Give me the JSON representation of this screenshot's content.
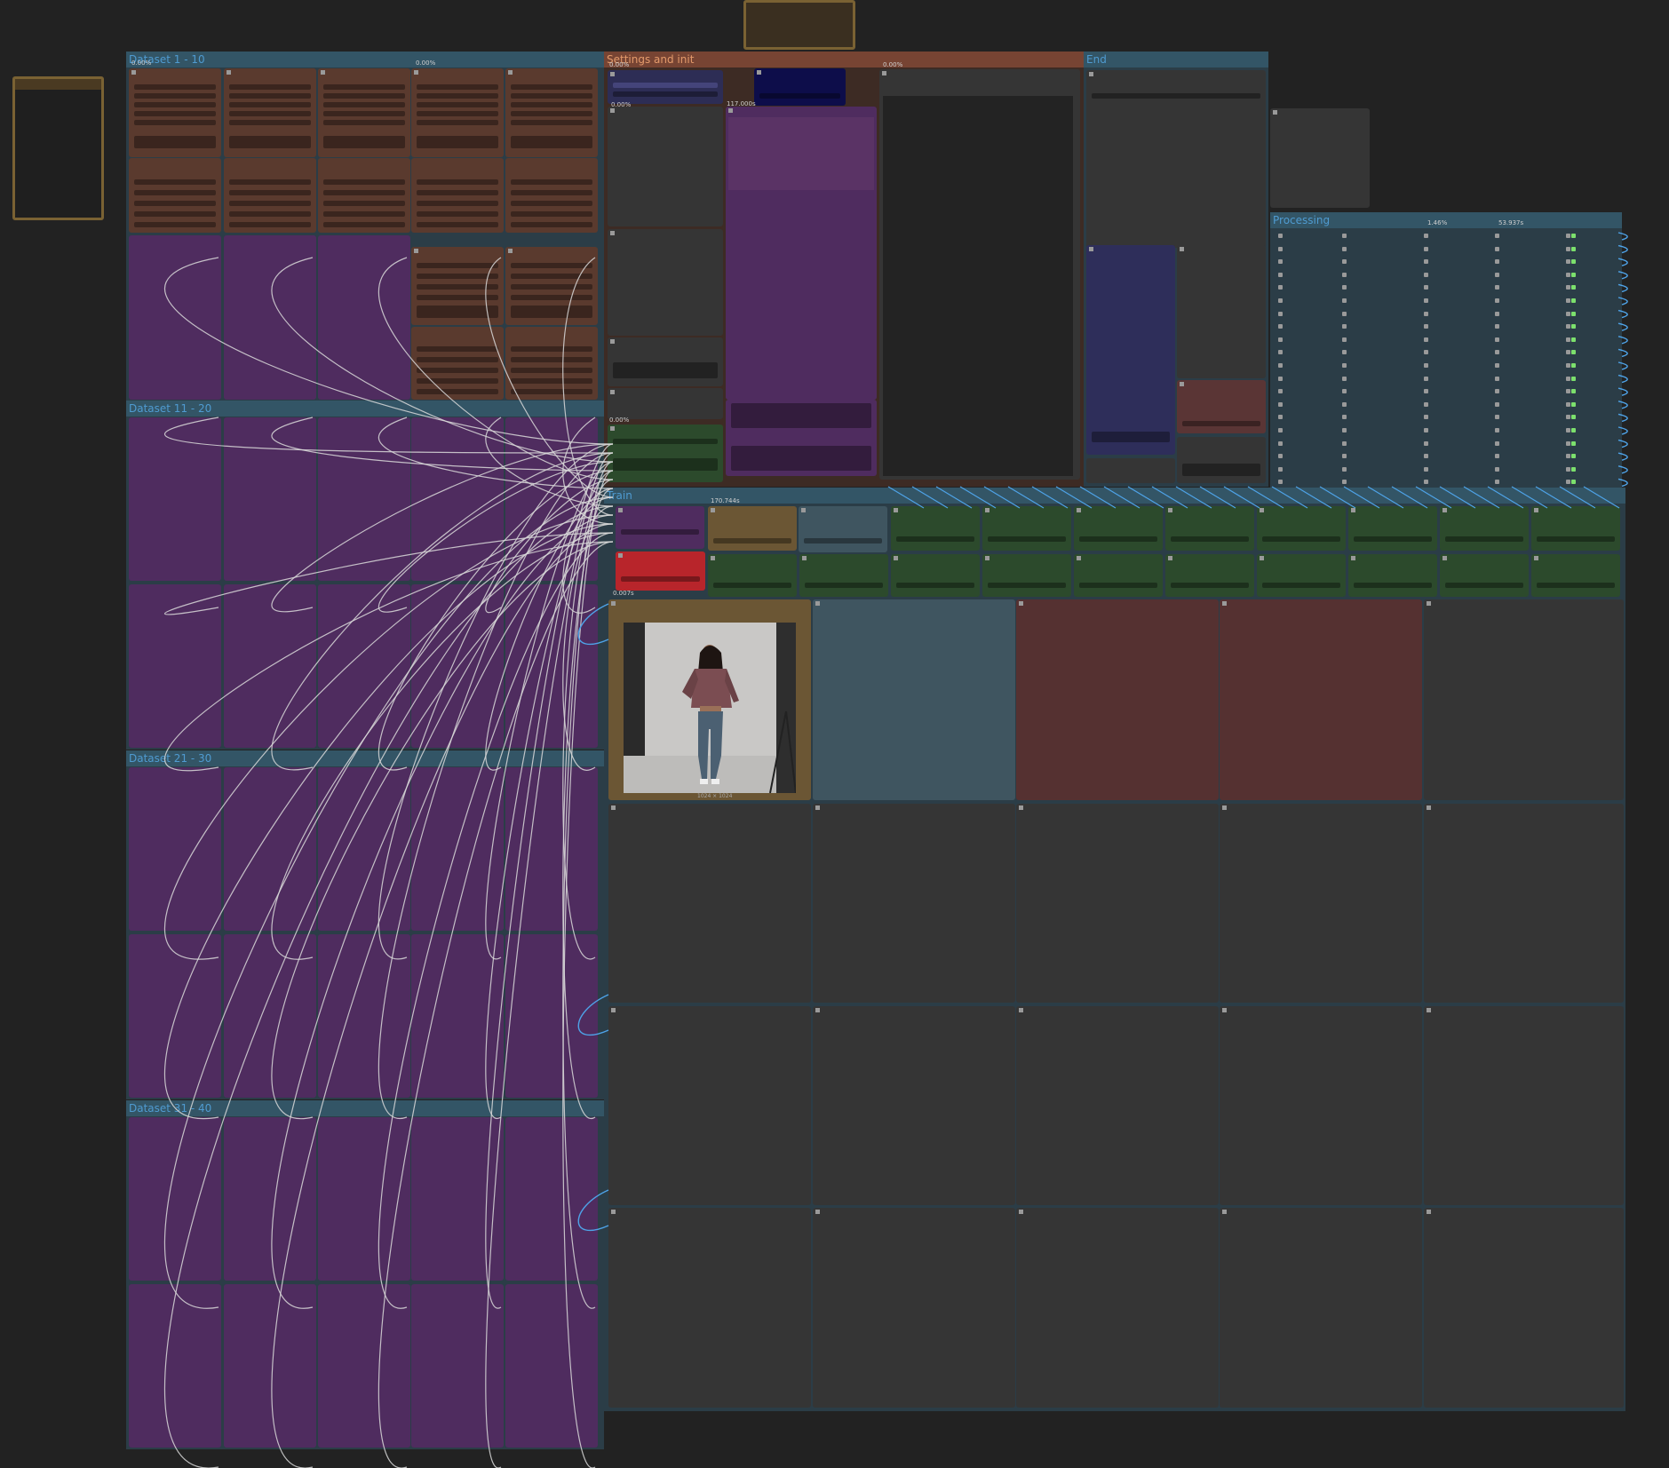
{
  "groups": {
    "dataset_1_10": "Dataset 1 - 10",
    "dataset_11_20": "Dataset 11 - 20",
    "dataset_21_30": "Dataset 21 - 30",
    "dataset_31_40": "Dataset 31 - 40",
    "settings_and_init": "Settings and init",
    "end": "End",
    "processing": "Processing",
    "train": "Train"
  },
  "badges": {
    "ds_a": "0.00%",
    "ds_b": "0.00%",
    "settings_a": "0.00%",
    "settings_b": "0.00%",
    "settings_c": "117.000s",
    "settings_d": "0.00%",
    "settings_e": "0.00%",
    "settings_f": "0.00%",
    "train_a": "170.744s",
    "train_b": "0.007s",
    "proc_a": "1.46%",
    "proc_b": "53.937s"
  },
  "preview": {
    "caption": "1024 × 1024"
  },
  "colors": {
    "background": "#222222",
    "group_blue": "#335566",
    "group_orange": "#774433",
    "node_brown": "#5a3a2e",
    "node_purple": "#4f2c5f",
    "node_green": "#2c4a2c",
    "node_red": "#b8252b",
    "node_navy": "#0d0d4a",
    "node_grey": "#353535",
    "wire_white": "#d9d9d9",
    "wire_blue": "#4ea3e8",
    "link_green": "#7ce06d"
  }
}
